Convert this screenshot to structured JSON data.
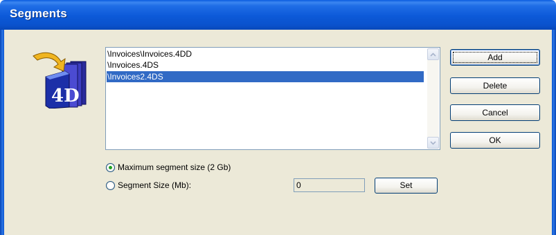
{
  "window": {
    "title": "Segments"
  },
  "segments_list": {
    "items": [
      {
        "label": "\\Invoices\\Invoices.4DD",
        "selected": false
      },
      {
        "label": "\\Invoices.4DS",
        "selected": false
      },
      {
        "label": "\\Invoices2.4DS",
        "selected": true
      }
    ]
  },
  "buttons": {
    "add": "Add",
    "delete": "Delete",
    "cancel": "Cancel",
    "ok": "OK",
    "set": "Set"
  },
  "options": {
    "max_segment_label": "Maximum segment size (2 Gb)",
    "max_segment_checked": true,
    "segment_size_label": "Segment Size (Mb):",
    "segment_size_checked": false,
    "segment_size_value": "0"
  },
  "colors": {
    "title_bar": "#0a5ce0",
    "dialog_bg": "#ece9d8",
    "selection": "#316ac5"
  },
  "icons": {
    "logo": "4d-database-icon",
    "scroll_up": "scroll-up-arrow-icon",
    "scroll_down": "scroll-down-arrow-icon"
  }
}
